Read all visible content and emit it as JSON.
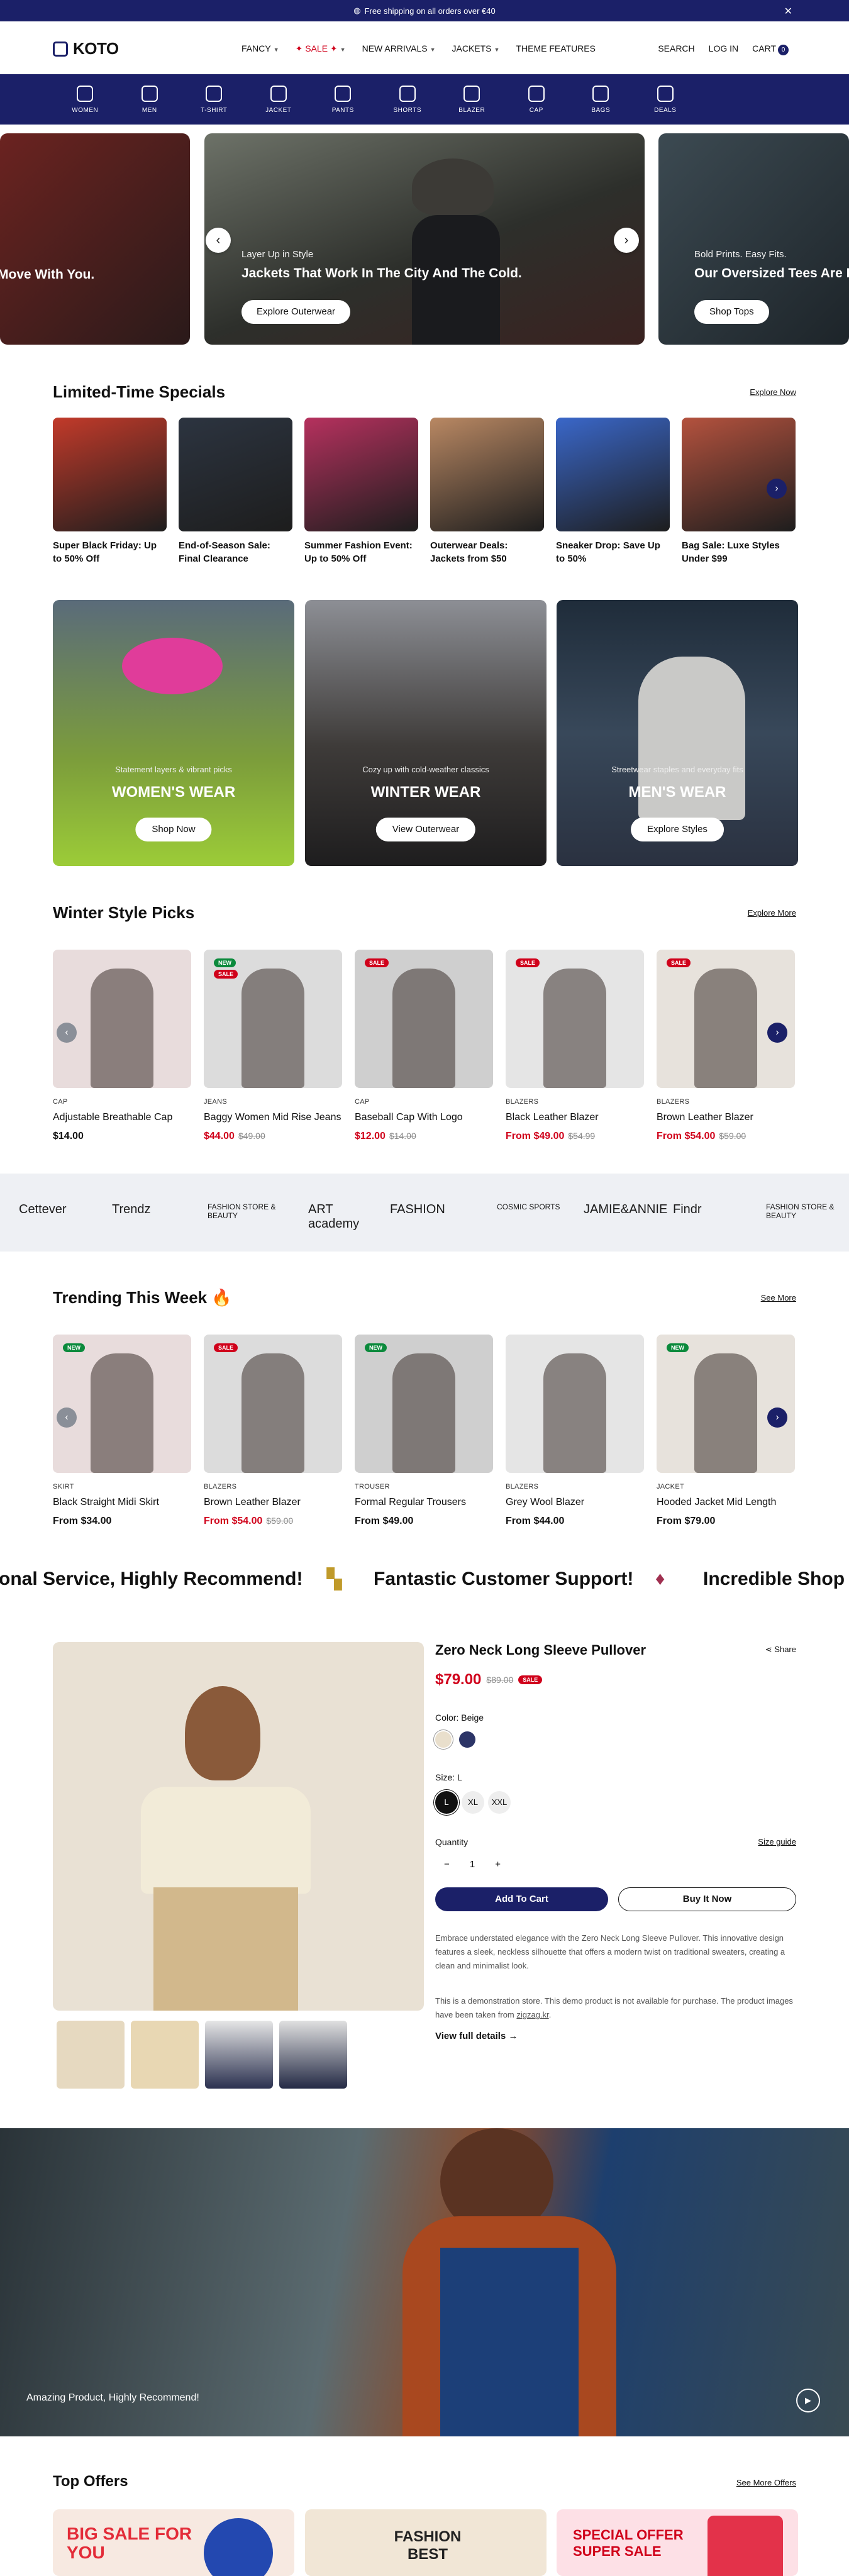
{
  "topbar": {
    "text": "Free shipping on all orders over €40"
  },
  "header": {
    "logo": "KOTO",
    "nav": [
      {
        "label": "FANCY",
        "sale": false,
        "chev": true
      },
      {
        "label": "✦ SALE ✦",
        "sale": true,
        "chev": true
      },
      {
        "label": "NEW ARRIVALS",
        "sale": false,
        "chev": true
      },
      {
        "label": "JACKETS",
        "sale": false,
        "chev": true
      },
      {
        "label": "THEME FEATURES",
        "sale": false,
        "chev": false
      }
    ],
    "search": "SEARCH",
    "login": "LOG IN",
    "cart": "CART",
    "cart_count": "0"
  },
  "categories": [
    "WOMEN",
    "MEN",
    "T-SHIRT",
    "JACKET",
    "PANTS",
    "SHORTS",
    "BLAZER",
    "CAP",
    "BAGS",
    "DEALS"
  ],
  "hero": {
    "left_title": "Move With You.",
    "center_kicker": "Layer Up in Style",
    "center_title": "Jackets That Work In The City And The Cold.",
    "center_button": "Explore Outerwear",
    "right_kicker": "Bold Prints. Easy Fits.",
    "right_title": "Our Oversized Tees Are B",
    "right_button": "Shop Tops"
  },
  "specials": {
    "title": "Limited-Time Specials",
    "link": "Explore Now",
    "items": [
      {
        "caption": "Super Black Friday: Up to 50% Off",
        "color": "#c23a2a"
      },
      {
        "caption": "End-of-Season Sale: Final Clearance",
        "color": "#2c3440"
      },
      {
        "caption": "Summer Fashion Event: Up to 50% Off",
        "color": "#b6315e"
      },
      {
        "caption": "Outerwear Deals: Jackets from $50",
        "color": "#b98863"
      },
      {
        "caption": "Sneaker Drop: Save Up to 50%",
        "color": "#3a67c9"
      },
      {
        "caption": "Bag Sale: Luxe Styles Under $99",
        "color": "#b4523e"
      }
    ]
  },
  "promos": [
    {
      "sub": "Statement layers & vibrant picks",
      "head": "WOMEN'S WEAR",
      "button": "Shop Now"
    },
    {
      "sub": "Cozy up with cold-weather classics",
      "head": "WINTER WEAR",
      "button": "View Outerwear"
    },
    {
      "sub": "Streetwear staples and everyday fits",
      "head": "MEN'S WEAR",
      "button": "Explore Styles"
    }
  ],
  "winter": {
    "title": "Winter Style Picks",
    "link": "Explore More",
    "products": [
      {
        "cat": "CAP",
        "name": "Adjustable Breathable Cap",
        "price": "$14.00",
        "old": "",
        "tags": [],
        "sale": false
      },
      {
        "cat": "JEANS",
        "name": "Baggy Women Mid Rise Jeans",
        "price": "$44.00",
        "old": "$49.00",
        "tags": [
          "NEW",
          "SALE"
        ],
        "sale": true
      },
      {
        "cat": "CAP",
        "name": "Baseball Cap With Logo",
        "price": "$12.00",
        "old": "$14.00",
        "tags": [
          "SALE"
        ],
        "sale": true
      },
      {
        "cat": "BLAZERS",
        "name": "Black Leather Blazer",
        "price": "From $49.00",
        "old": "$54.99",
        "tags": [
          "SALE"
        ],
        "sale": true
      },
      {
        "cat": "BLAZERS",
        "name": "Brown Leather Blazer",
        "price": "From $54.00",
        "old": "$59.00",
        "tags": [
          "SALE"
        ],
        "sale": true
      }
    ]
  },
  "brands": [
    "Cettever",
    "Trendz",
    "FASHION STORE & BEAUTY",
    "ART academy",
    "FASHION",
    "COSMIC SPORTS",
    "JAMIE&ANNIE",
    "Findr",
    "FASHION STORE & BEAUTY"
  ],
  "trending": {
    "title": "Trending This Week 🔥",
    "link": "See More",
    "products": [
      {
        "cat": "SKIRT",
        "name": "Black Straight Midi Skirt",
        "price": "From $34.00",
        "old": "",
        "tags": [
          "NEW"
        ],
        "sale": false
      },
      {
        "cat": "BLAZERS",
        "name": "Brown Leather Blazer",
        "price": "From $54.00",
        "old": "$59.00",
        "tags": [
          "SALE"
        ],
        "sale": true
      },
      {
        "cat": "TROUSER",
        "name": "Formal Regular Trousers",
        "price": "From $49.00",
        "old": "",
        "tags": [
          "NEW"
        ],
        "sale": false
      },
      {
        "cat": "BLAZERS",
        "name": "Grey Wool Blazer",
        "price": "From $44.00",
        "old": "",
        "tags": [],
        "sale": false
      },
      {
        "cat": "JACKET",
        "name": "Hooded Jacket Mid Length",
        "price": "From $79.00",
        "old": "",
        "tags": [
          "NEW"
        ],
        "sale": false
      }
    ]
  },
  "marquee": [
    "onal Service, Highly Recommend!",
    "Fantastic Customer Support!",
    "Incredible Shop"
  ],
  "product": {
    "name": "Zero Neck Long Sleeve Pullover",
    "share": "Share",
    "price": "$79.00",
    "old": "$89.00",
    "badge": "SALE",
    "color_label": "Color:",
    "color_value": "Beige",
    "size_label": "Size:",
    "size_value": "L",
    "sizes": [
      "L",
      "XL",
      "XXL"
    ],
    "quantity_label": "Quantity",
    "size_guide": "Size guide",
    "qty": "1",
    "add_to_cart": "Add To Cart",
    "buy_now": "Buy It Now",
    "desc1": "Embrace understated elegance with the Zero Neck Long Sleeve Pullover. This innovative design features a sleek, neckless silhouette that offers a modern twist on traditional sweaters, creating a clean and minimalist look.",
    "desc2": "This is a demonstration store. This demo product is not available for purchase. The product images have been taken from",
    "desc2_link": "zigzag.kr",
    "full_details": "View full details"
  },
  "video": {
    "caption": "Amazing Product, Highly Recommend!"
  },
  "offers": {
    "title": "Top Offers",
    "link": "See More Offers",
    "tiles": [
      "BIG SALE FOR YOU",
      "FASHION BEST",
      "SPECIAL OFFER SUPER SALE"
    ]
  }
}
